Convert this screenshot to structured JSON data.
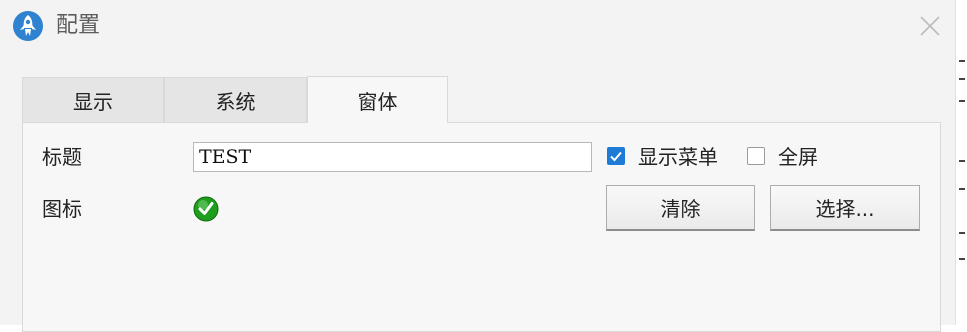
{
  "window": {
    "title": "配置",
    "app_icon": "rocket-app-icon",
    "close_icon": "close-icon"
  },
  "tabs": [
    {
      "label": "显示",
      "selected": false
    },
    {
      "label": "系统",
      "selected": false
    },
    {
      "label": "窗体",
      "selected": true
    }
  ],
  "form": {
    "title_label": "标题",
    "title_value": "TEST",
    "icon_label": "图标",
    "icon_preview": "green-checkmark-icon",
    "show_menu_label": "显示菜单",
    "show_menu_checked": true,
    "fullscreen_label": "全屏",
    "fullscreen_checked": false,
    "clear_button": "清除",
    "select_button": "选择..."
  },
  "colors": {
    "accent": "#1f7cd6",
    "icon_green": "#1f9d1f"
  }
}
